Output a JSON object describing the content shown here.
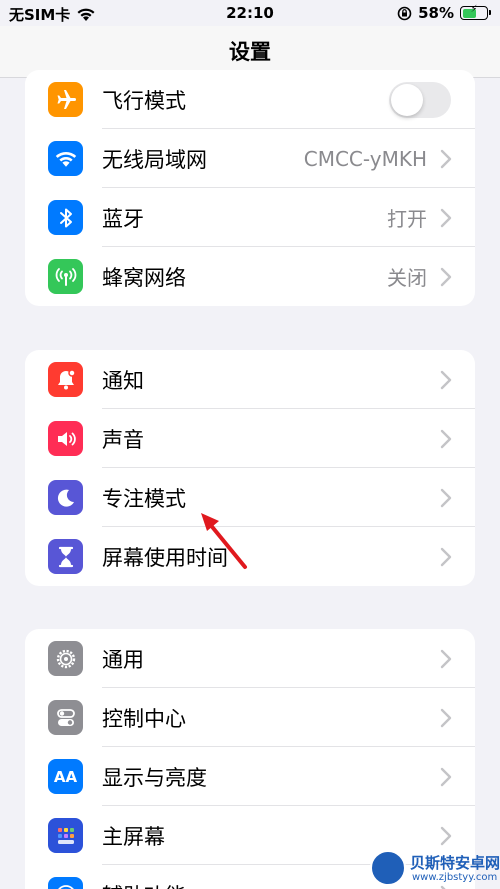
{
  "status_bar": {
    "carrier": "无SIM卡",
    "time": "22:10",
    "battery_percent": "58%",
    "battery_level": 0.58
  },
  "nav": {
    "title": "设置"
  },
  "groups": [
    {
      "rows": [
        {
          "label": "飞行模式",
          "icon": "airplane-icon",
          "icon_color": "#ff9500",
          "control": "toggle",
          "toggle_on": false
        },
        {
          "label": "无线局域网",
          "icon": "wifi-icon",
          "icon_color": "#007aff",
          "value": "CMCC-yMKH"
        },
        {
          "label": "蓝牙",
          "icon": "bluetooth-icon",
          "icon_color": "#007aff",
          "value": "打开"
        },
        {
          "label": "蜂窝网络",
          "icon": "antenna-icon",
          "icon_color": "#34c759",
          "value": "关闭"
        }
      ]
    },
    {
      "rows": [
        {
          "label": "通知",
          "icon": "bell-icon",
          "icon_color": "#ff3b30"
        },
        {
          "label": "声音",
          "icon": "speaker-icon",
          "icon_color": "#ff2d55"
        },
        {
          "label": "专注模式",
          "icon": "moon-icon",
          "icon_color": "#5856d6"
        },
        {
          "label": "屏幕使用时间",
          "icon": "hourglass-icon",
          "icon_color": "#5856d6"
        }
      ]
    },
    {
      "rows": [
        {
          "label": "通用",
          "icon": "gear-icon",
          "icon_color": "#8e8e93"
        },
        {
          "label": "控制中心",
          "icon": "switches-icon",
          "icon_color": "#8e8e93"
        },
        {
          "label": "显示与亮度",
          "icon": "text-size-icon",
          "icon_color": "#007aff"
        },
        {
          "label": "主屏幕",
          "icon": "home-grid-icon",
          "icon_color": "#2c52d9"
        },
        {
          "label": "辅助功能",
          "icon": "accessibility-icon",
          "icon_color": "#007aff"
        }
      ]
    }
  ],
  "annotation": {
    "type": "red-arrow",
    "color": "#e0191e",
    "points_to": "专注模式"
  },
  "watermark": {
    "title": "贝斯特安卓网",
    "url": "www.zjbstyy.com"
  }
}
